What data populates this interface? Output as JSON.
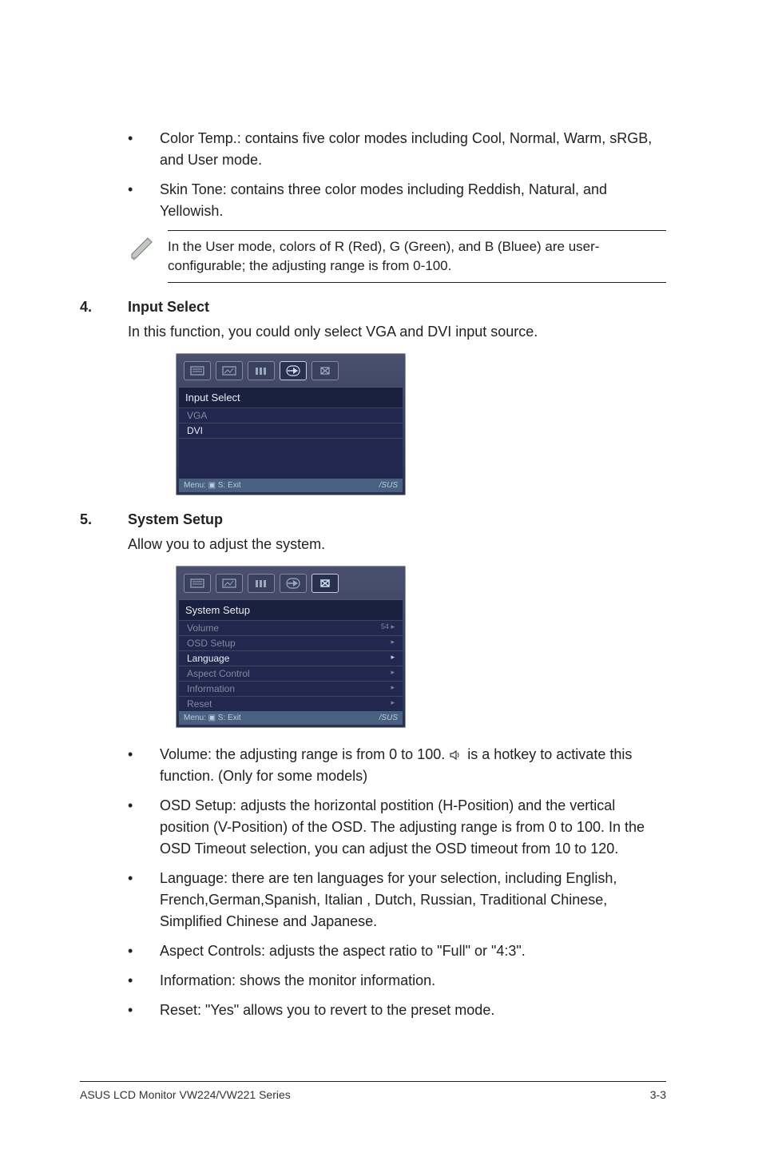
{
  "top_bullets": [
    "Color Temp.: contains five color modes including Cool, Normal, Warm, sRGB, and User mode.",
    "Skin Tone: contains three color modes including Reddish, Natural, and Yellowish."
  ],
  "note": "In the User mode, colors of R (Red), G (Green), and B (Bluee) are user-configurable; the adjusting range is from 0-100.",
  "sec4": {
    "num": "4.",
    "title": "Input Select",
    "desc": "In this function, you could only select  VGA  and DVI input source."
  },
  "osd1": {
    "title": "Input Select",
    "rows": [
      {
        "label": "VGA",
        "enabled": false
      },
      {
        "label": "DVI",
        "enabled": true
      }
    ],
    "footer_left": "Menu: ▣    S: Exit",
    "footer_right": "/SUS"
  },
  "sec5": {
    "num": "5.",
    "title": "System Setup",
    "desc": "Allow you to adjust the system."
  },
  "osd2": {
    "title": "System Setup",
    "rows": [
      {
        "label": "Volume",
        "right": "54 ▸",
        "enabled": false
      },
      {
        "label": "OSD Setup",
        "right": "▸",
        "enabled": false
      },
      {
        "label": "Language",
        "right": "▸",
        "enabled": true
      },
      {
        "label": "Aspect Control",
        "right": "▸",
        "enabled": false
      },
      {
        "label": "Information",
        "right": "▸",
        "enabled": false
      },
      {
        "label": "Reset",
        "right": "▸",
        "enabled": false
      }
    ],
    "footer_left": "Menu: ▣    S: Exit",
    "footer_right": "/SUS"
  },
  "bottom_bullets": [
    {
      "pre": "Volume: the adjusting range is from 0 to 100.  ",
      "post": "  is a hotkey to activate this function. (Only for some models)",
      "icon": true
    },
    {
      "pre": "OSD Setup: adjusts the horizontal postition (H-Position) and the vertical position (V-Position) of the OSD. The adjusting range is from 0 to 100. In the OSD Timeout selection, you can adjust the OSD timeout from 10 to 120."
    },
    {
      "pre": "Language: there are ten languages for your selection, including English, French,German,Spanish, Italian , Dutch,  Russian, Traditional Chinese, Simplified Chinese and Japanese."
    },
    {
      "pre": "Aspect Controls: adjusts the aspect ratio to \"Full\" or \"4:3\"."
    },
    {
      "pre": "Information: shows the monitor information."
    },
    {
      "pre": "Reset: \"Yes\" allows you to revert to the preset mode."
    }
  ],
  "footer": {
    "left": "ASUS LCD Monitor VW224/VW221 Series",
    "right": "3-3"
  }
}
